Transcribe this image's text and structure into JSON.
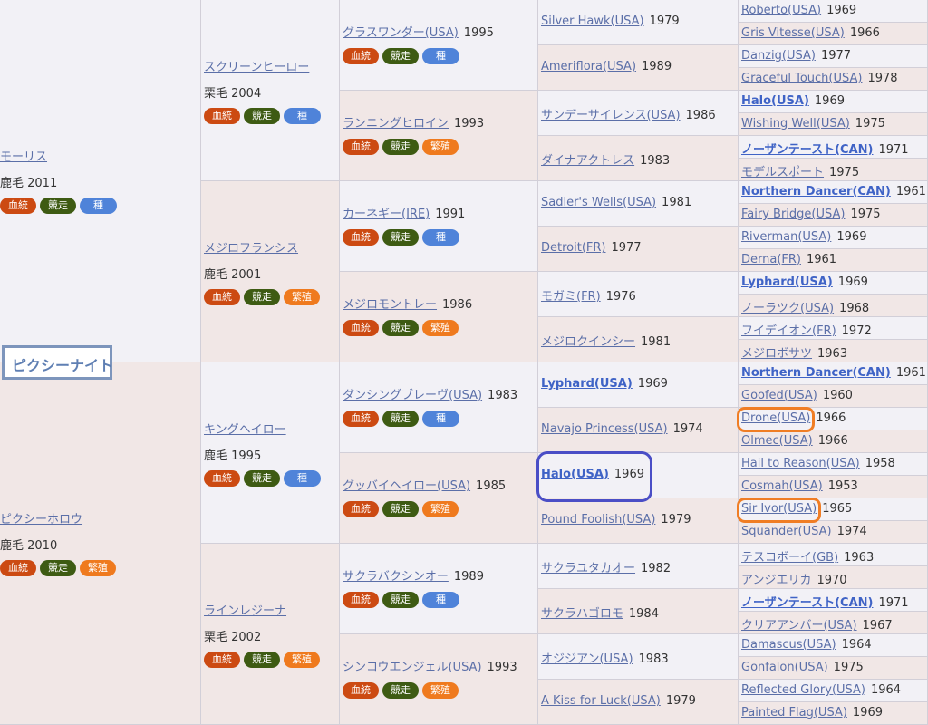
{
  "horse_title": "ピクシーナイト",
  "badge_labels": {
    "blood": "血統",
    "race": "競走",
    "stud": "種",
    "breed": "繁殖"
  },
  "gen1": [
    {
      "name": "モーリス",
      "coat": "鹿毛 2011",
      "third": "種"
    },
    {
      "name": "ピクシーホロウ",
      "coat": "鹿毛 2010",
      "third": "繁殖"
    }
  ],
  "gen2": [
    {
      "name": "スクリーンヒーロー",
      "coat": "栗毛 2004",
      "third": "種"
    },
    {
      "name": "メジロフランシス",
      "coat": "鹿毛 2001",
      "third": "繁殖"
    },
    {
      "name": "キングヘイロー",
      "coat": "鹿毛 1995",
      "third": "種"
    },
    {
      "name": "ラインレジーナ",
      "coat": "栗毛 2002",
      "third": "繁殖"
    }
  ],
  "gen3": [
    {
      "name": "グラスワンダー(USA)",
      "year": "1995",
      "third": "種"
    },
    {
      "name": "ランニングヒロイン",
      "year": "1993",
      "third": "繁殖"
    },
    {
      "name": "カーネギー(IRE)",
      "year": "1991",
      "third": "種"
    },
    {
      "name": "メジロモントレー",
      "year": "1986",
      "third": "繁殖"
    },
    {
      "name": "ダンシングブレーヴ(USA)",
      "year": "1983",
      "third": "種"
    },
    {
      "name": "グッバイヘイロー(USA)",
      "year": "1985",
      "third": "繁殖"
    },
    {
      "name": "サクラバクシンオー",
      "year": "1989",
      "third": "種"
    },
    {
      "name": "シンコウエンジェル(USA)",
      "year": "1993",
      "third": "繁殖"
    }
  ],
  "gen4": [
    {
      "name": "Silver Hawk(USA)",
      "year": "1979"
    },
    {
      "name": "Ameriflora(USA)",
      "year": "1989"
    },
    {
      "name": "サンデーサイレンス(USA)",
      "year": "1986"
    },
    {
      "name": "ダイナアクトレス",
      "year": "1983"
    },
    {
      "name": "Sadler's Wells(USA)",
      "year": "1981"
    },
    {
      "name": "Detroit(FR)",
      "year": "1977"
    },
    {
      "name": "モガミ(FR)",
      "year": "1976"
    },
    {
      "name": "メジロクインシー",
      "year": "1981"
    },
    {
      "name": "Lyphard(USA)",
      "year": "1969",
      "bold": true
    },
    {
      "name": "Navajo Princess(USA)",
      "year": "1974"
    },
    {
      "name": "Halo(USA)",
      "year": "1969",
      "bold": true
    },
    {
      "name": "Pound Foolish(USA)",
      "year": "1979"
    },
    {
      "name": "サクラユタカオー",
      "year": "1982"
    },
    {
      "name": "サクラハゴロモ",
      "year": "1984"
    },
    {
      "name": "オジジアン(USA)",
      "year": "1983"
    },
    {
      "name": "A Kiss for Luck(USA)",
      "year": "1979"
    }
  ],
  "gen5": [
    {
      "name": "Roberto(USA)",
      "year": "1969"
    },
    {
      "name": "Gris Vitesse(USA)",
      "year": "1966"
    },
    {
      "name": "Danzig(USA)",
      "year": "1977"
    },
    {
      "name": "Graceful Touch(USA)",
      "year": "1978"
    },
    {
      "name": "Halo(USA)",
      "year": "1969",
      "bold": true
    },
    {
      "name": "Wishing Well(USA)",
      "year": "1975"
    },
    {
      "name": "ノーザンテースト(CAN)",
      "year": "1971",
      "bold": true
    },
    {
      "name": "モデルスポート",
      "year": "1975"
    },
    {
      "name": "Northern Dancer(CAN)",
      "year": "1961",
      "bold": true
    },
    {
      "name": "Fairy Bridge(USA)",
      "year": "1975"
    },
    {
      "name": "Riverman(USA)",
      "year": "1969"
    },
    {
      "name": "Derna(FR)",
      "year": "1961"
    },
    {
      "name": "Lyphard(USA)",
      "year": "1969",
      "bold": true
    },
    {
      "name": "ノーラツク(USA)",
      "year": "1968"
    },
    {
      "name": "フイデイオン(FR)",
      "year": "1972"
    },
    {
      "name": "メジロボサツ",
      "year": "1963"
    },
    {
      "name": "Northern Dancer(CAN)",
      "year": "1961",
      "bold": true
    },
    {
      "name": "Goofed(USA)",
      "year": "1960"
    },
    {
      "name": "Drone(USA)",
      "year": "1966"
    },
    {
      "name": "Olmec(USA)",
      "year": "1966"
    },
    {
      "name": "Hail to Reason(USA)",
      "year": "1958"
    },
    {
      "name": "Cosmah(USA)",
      "year": "1953"
    },
    {
      "name": "Sir Ivor(USA)",
      "year": "1965"
    },
    {
      "name": "Squander(USA)",
      "year": "1974"
    },
    {
      "name": "テスコボーイ(GB)",
      "year": "1963"
    },
    {
      "name": "アンジエリカ",
      "year": "1970"
    },
    {
      "name": "ノーザンテースト(CAN)",
      "year": "1971",
      "bold": true
    },
    {
      "name": "クリアアンバー(USA)",
      "year": "1967"
    },
    {
      "name": "Damascus(USA)",
      "year": "1964"
    },
    {
      "name": "Gonfalon(USA)",
      "year": "1975"
    },
    {
      "name": "Reflected Glory(USA)",
      "year": "1964"
    },
    {
      "name": "Painted Flag(USA)",
      "year": "1969"
    }
  ],
  "highlights": [
    {
      "target": "gen4.10",
      "color": "#4a4ec6"
    },
    {
      "target": "gen5.18",
      "color": "#f07d24"
    },
    {
      "target": "gen5.22",
      "color": "#f07d24"
    }
  ]
}
